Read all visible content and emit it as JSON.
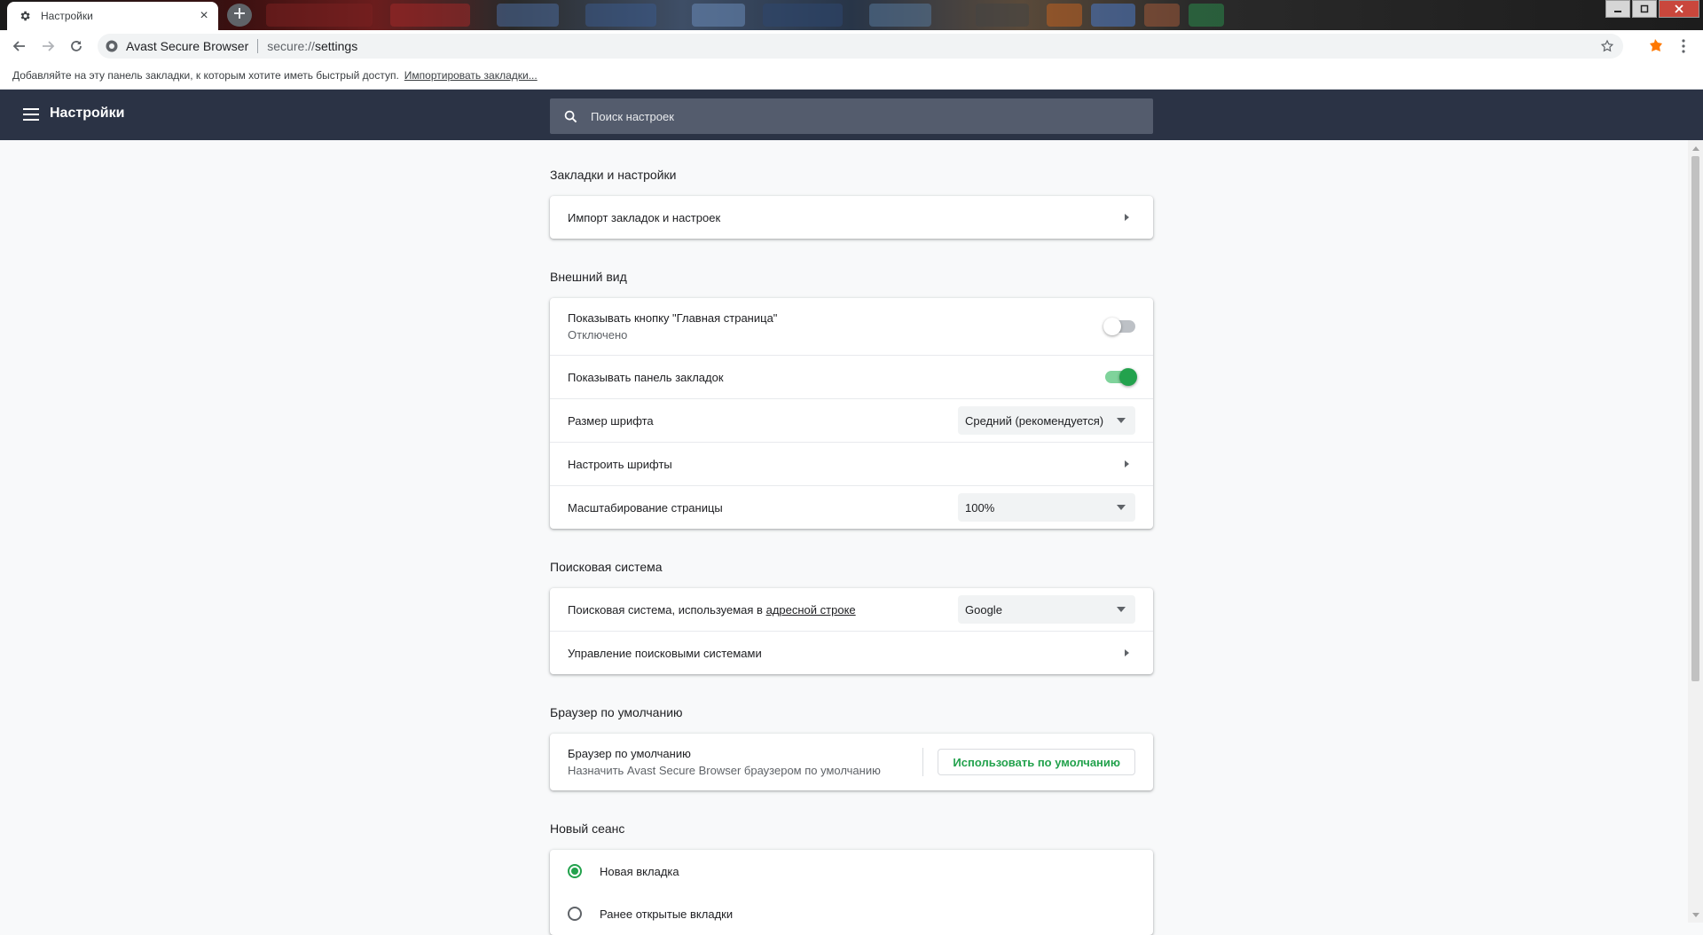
{
  "tab": {
    "title": "Настройки",
    "close_glyph": "×"
  },
  "omnibox": {
    "site_name": "Avast Secure Browser",
    "url_scheme": "secure://",
    "url_path": "settings"
  },
  "bookmarks_bar": {
    "hint": "Добавляйте на эту панель закладки, к которым хотите иметь быстрый доступ.",
    "import_link": "Импортировать закладки..."
  },
  "header": {
    "title": "Настройки",
    "search_placeholder": "Поиск настроек"
  },
  "sections": {
    "bookmarks": {
      "title": "Закладки и настройки",
      "import_row": "Импорт закладок и настроек"
    },
    "appearance": {
      "title": "Внешний вид",
      "home_button": {
        "label": "Показывать кнопку \"Главная страница\"",
        "status": "Отключено",
        "enabled": false
      },
      "bookmarks_bar": {
        "label": "Показывать панель закладок",
        "enabled": true
      },
      "font_size": {
        "label": "Размер шрифта",
        "value": "Средний (рекомендуется)"
      },
      "customize_fonts": {
        "label": "Настроить шрифты"
      },
      "page_zoom": {
        "label": "Масштабирование страницы",
        "value": "100%"
      }
    },
    "search_engine": {
      "title": "Поисковая система",
      "engine_row": {
        "label_prefix": "Поисковая система, используемая в",
        "label_link": "адресной строке",
        "value": "Google"
      },
      "manage_row": "Управление поисковыми системами"
    },
    "default_browser": {
      "title": "Браузер по умолчанию",
      "label": "Браузер по умолчанию",
      "sub": "Назначить Avast Secure Browser браузером по умолчанию",
      "button": "Использовать по умолчанию"
    },
    "startup": {
      "title": "Новый сеанс",
      "options": [
        "Новая вкладка",
        "Ранее открытые вкладки"
      ],
      "selected_index": 0
    }
  },
  "colors": {
    "header_bg": "#2b3345",
    "accent_green": "#23a24d",
    "page_bg": "#f8f9fa"
  },
  "icons": [
    "gear-icon",
    "close-icon",
    "plus-icon",
    "back-icon",
    "forward-icon",
    "reload-icon",
    "avast-site-icon",
    "star-icon",
    "avast-extension-icon",
    "kebab-menu-icon",
    "hamburger-icon",
    "search-icon",
    "chevron-right-icon",
    "caret-down-icon"
  ]
}
